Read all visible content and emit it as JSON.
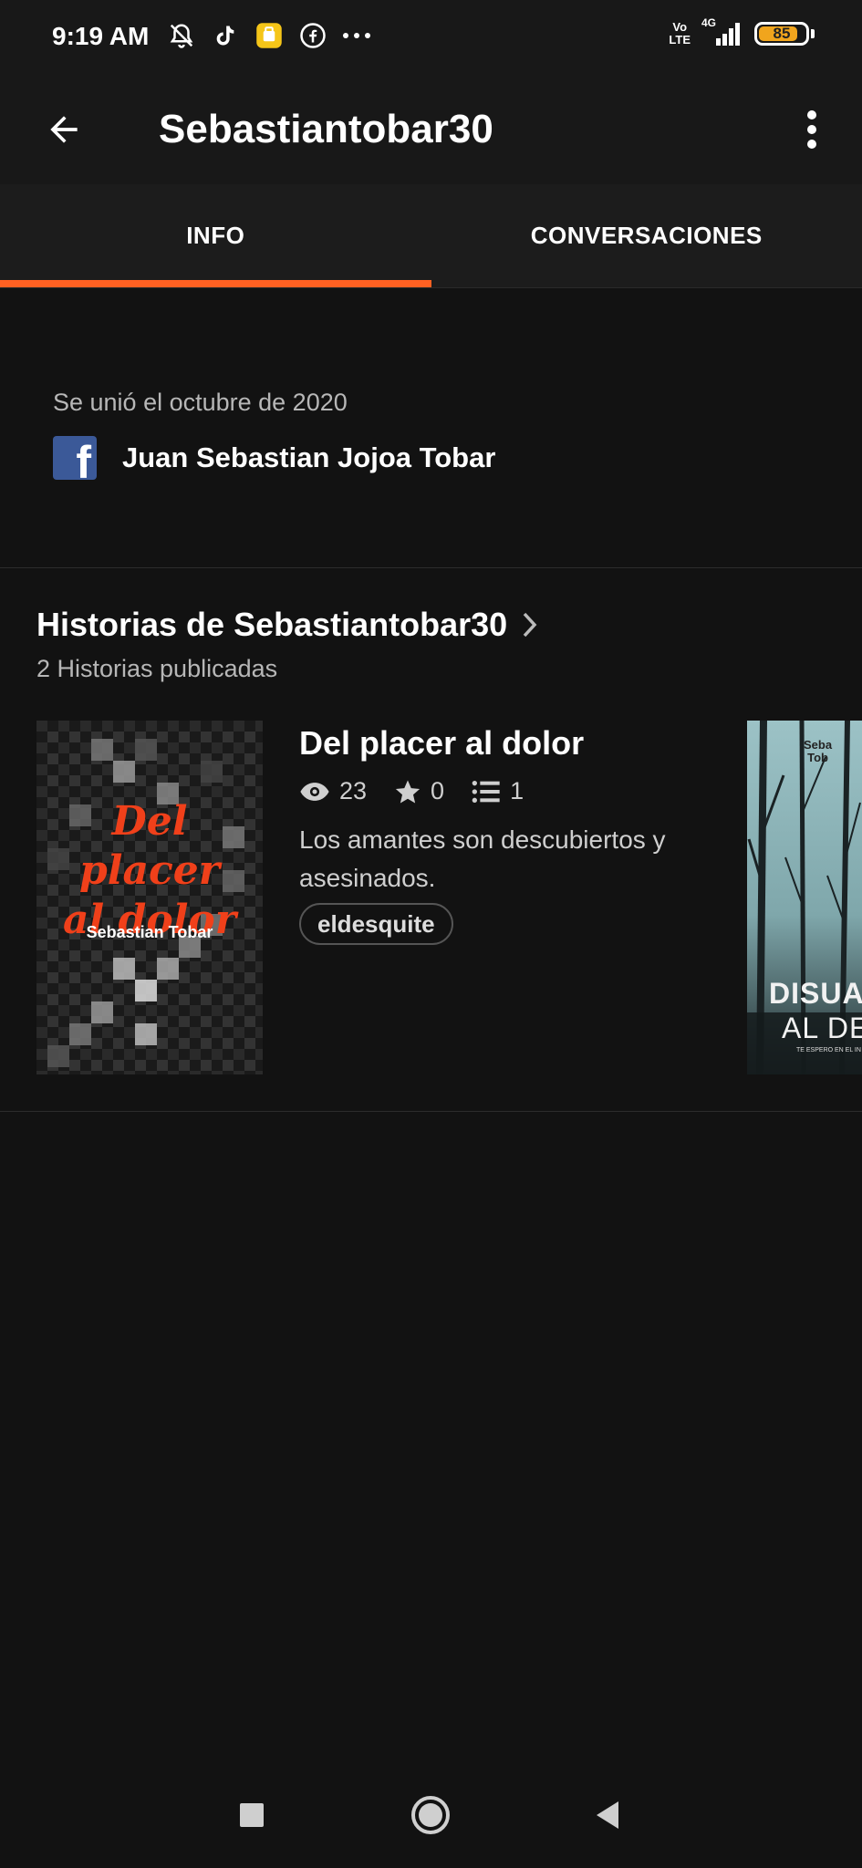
{
  "status_bar": {
    "time": "9:19 AM",
    "network_label_top": "Vo",
    "network_label_bottom": "LTE",
    "signal_label": "4G",
    "battery_level": "85",
    "icons": [
      "muted-bell-icon",
      "tiktok-icon",
      "app-notification-icon",
      "facebook-circle-icon",
      "more-dots-icon"
    ]
  },
  "header": {
    "title": "Sebastiantobar30",
    "back_icon": "arrow-left-icon",
    "more_icon": "more-vertical-icon"
  },
  "tabs": [
    {
      "label": "INFO",
      "active": true
    },
    {
      "label": "CONVERSACIONES",
      "active": false
    }
  ],
  "info": {
    "joined": "Se unió el octubre de 2020",
    "facebook_name": "Juan Sebastian Jojoa Tobar"
  },
  "stories": {
    "title": "Historias de Sebastiantobar30",
    "count_text": "2 Historias publicadas",
    "items": [
      {
        "cover_title_line1": "Del placer",
        "cover_title_line2": "al dolor",
        "cover_author": "Sebastian Tobar",
        "title": "Del placer al dolor",
        "views": "23",
        "votes": "0",
        "parts": "1",
        "description": "Los amantes son descubiertos y asesinados.",
        "tag": "eldesquite"
      },
      {
        "cover_author_line1": "Seba",
        "cover_author_line2": "Tob",
        "cover_title_line1": "DISUAD",
        "cover_title_line2": "AL DEI",
        "cover_subtitle": "TE ESPERO EN EL IN"
      }
    ]
  },
  "colors": {
    "accent": "#ff6122",
    "background": "#121212",
    "facebook": "#3b5998"
  }
}
